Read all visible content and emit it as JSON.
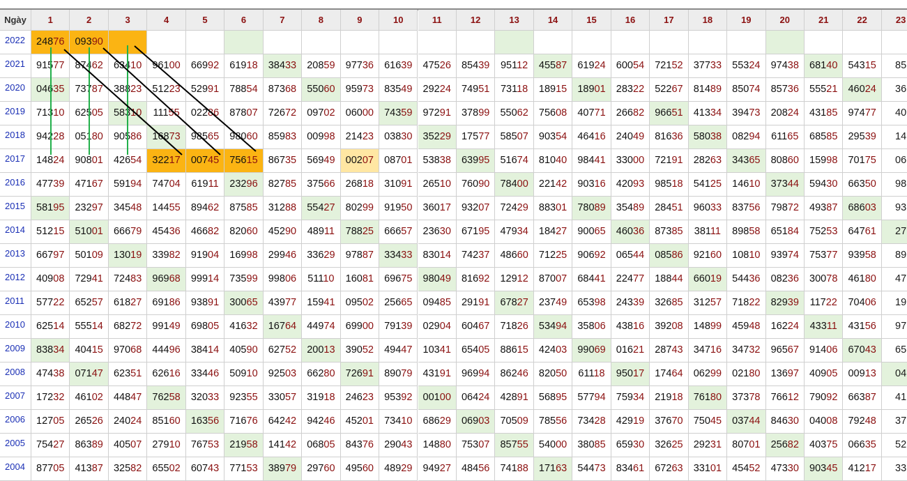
{
  "header": {
    "first": "Ngày",
    "days": [
      "1",
      "2",
      "3",
      "4",
      "5",
      "6",
      "7",
      "8",
      "9",
      "10",
      "11",
      "12",
      "13",
      "14",
      "15",
      "16",
      "17",
      "18",
      "19",
      "20",
      "21",
      "22",
      "23"
    ]
  },
  "rows": [
    {
      "year": "2022",
      "values": [
        "24876",
        "09390",
        "",
        "",
        "",
        "",
        "",
        "",
        "",
        "",
        "",
        "",
        "",
        "",
        "",
        "",
        "",
        "",
        "",
        "",
        "",
        "",
        ""
      ],
      "hl": {
        "0": "o",
        "1": "o",
        "2": "o",
        "5": "g",
        "12": "g",
        "19": "g"
      }
    },
    {
      "year": "2021",
      "values": [
        "91577",
        "87462",
        "63410",
        "96100",
        "66992",
        "61918",
        "38433",
        "20859",
        "97736",
        "61639",
        "47526",
        "85439",
        "95112",
        "45587",
        "61924",
        "60054",
        "72152",
        "37733",
        "55324",
        "97438",
        "68140",
        "54315",
        "85"
      ],
      "hl": {
        "6": "g",
        "13": "g",
        "20": "g"
      }
    },
    {
      "year": "2020",
      "values": [
        "04635",
        "73787",
        "38823",
        "51223",
        "52991",
        "78854",
        "87368",
        "55060",
        "95973",
        "83549",
        "29224",
        "74951",
        "73118",
        "18915",
        "18901",
        "28322",
        "52267",
        "81489",
        "85074",
        "85736",
        "55521",
        "46024",
        "36"
      ],
      "hl": {
        "0": "g",
        "7": "g",
        "14": "g",
        "21": "g"
      }
    },
    {
      "year": "2019",
      "values": [
        "71310",
        "62505",
        "58310",
        "11155",
        "02286",
        "87807",
        "72672",
        "09702",
        "06000",
        "74359",
        "97291",
        "37899",
        "55062",
        "75608",
        "40771",
        "26682",
        "96651",
        "41334",
        "39473",
        "20824",
        "43185",
        "97477",
        "40"
      ],
      "hl": {
        "2": "g",
        "9": "g",
        "16": "g"
      }
    },
    {
      "year": "2018",
      "values": [
        "94228",
        "05180",
        "90586",
        "16873",
        "98565",
        "98060",
        "85983",
        "00998",
        "21423",
        "03830",
        "35229",
        "17577",
        "58507",
        "90354",
        "46416",
        "24049",
        "81636",
        "58038",
        "08294",
        "61165",
        "68585",
        "29539",
        "14"
      ],
      "hl": {
        "3": "g",
        "10": "g",
        "17": "g"
      }
    },
    {
      "year": "2017",
      "values": [
        "14824",
        "90801",
        "42654",
        "32217",
        "00745",
        "75615",
        "86735",
        "56949",
        "00207",
        "08701",
        "53838",
        "63995",
        "51674",
        "81040",
        "98441",
        "33000",
        "72191",
        "28263",
        "34365",
        "80860",
        "15998",
        "70175",
        "06"
      ],
      "hl": {
        "3": "o",
        "4": "o",
        "5": "o",
        "8": "y",
        "11": "g",
        "18": "g"
      }
    },
    {
      "year": "2016",
      "values": [
        "47739",
        "47167",
        "59194",
        "74704",
        "61911",
        "23296",
        "82785",
        "37566",
        "26818",
        "31091",
        "26510",
        "76090",
        "78400",
        "22142",
        "90316",
        "42093",
        "98518",
        "54125",
        "14610",
        "37344",
        "59430",
        "66350",
        "98"
      ],
      "hl": {
        "5": "g",
        "12": "g",
        "19": "g"
      }
    },
    {
      "year": "2015",
      "values": [
        "58195",
        "23297",
        "34548",
        "14455",
        "89462",
        "87585",
        "31288",
        "55427",
        "80299",
        "91950",
        "36017",
        "93207",
        "72429",
        "88301",
        "78089",
        "35489",
        "28451",
        "96033",
        "83756",
        "79872",
        "49387",
        "68603",
        "93"
      ],
      "hl": {
        "0": "g",
        "7": "g",
        "14": "g",
        "21": "g"
      }
    },
    {
      "year": "2014",
      "values": [
        "51215",
        "51001",
        "66679",
        "45436",
        "46682",
        "82060",
        "45290",
        "48911",
        "78825",
        "66657",
        "23630",
        "67195",
        "47934",
        "18427",
        "90065",
        "46036",
        "87385",
        "38111",
        "89858",
        "65184",
        "75253",
        "64761",
        "27"
      ],
      "hl": {
        "1": "g",
        "8": "g",
        "15": "g",
        "22": "g"
      }
    },
    {
      "year": "2013",
      "values": [
        "66797",
        "50109",
        "13019",
        "33982",
        "91904",
        "16998",
        "29946",
        "33629",
        "97887",
        "33433",
        "83014",
        "74237",
        "48660",
        "71225",
        "90692",
        "06544",
        "08586",
        "92160",
        "10810",
        "93974",
        "75377",
        "93958",
        "89"
      ],
      "hl": {
        "2": "g",
        "9": "g",
        "16": "g"
      }
    },
    {
      "year": "2012",
      "values": [
        "40908",
        "72941",
        "72483",
        "96968",
        "99914",
        "73599",
        "99806",
        "51110",
        "16081",
        "69675",
        "98049",
        "81692",
        "12912",
        "87007",
        "68441",
        "22477",
        "18844",
        "66019",
        "54436",
        "08236",
        "30078",
        "46180",
        "47"
      ],
      "hl": {
        "3": "g",
        "10": "g",
        "17": "g"
      }
    },
    {
      "year": "2011",
      "values": [
        "57722",
        "65257",
        "61827",
        "69186",
        "93891",
        "30065",
        "43977",
        "15941",
        "09502",
        "25665",
        "09485",
        "29191",
        "67827",
        "23749",
        "65398",
        "24339",
        "32685",
        "31257",
        "71822",
        "82939",
        "11722",
        "70406",
        "19"
      ],
      "hl": {
        "5": "g",
        "12": "g",
        "19": "g"
      }
    },
    {
      "year": "2010",
      "values": [
        "62514",
        "55514",
        "68272",
        "99149",
        "69805",
        "41632",
        "16764",
        "44974",
        "69900",
        "79139",
        "02904",
        "60467",
        "71826",
        "53494",
        "35806",
        "43816",
        "39208",
        "14899",
        "45948",
        "16224",
        "43311",
        "43156",
        "97"
      ],
      "hl": {
        "6": "g",
        "13": "g",
        "20": "g"
      }
    },
    {
      "year": "2009",
      "values": [
        "83834",
        "40415",
        "97068",
        "44496",
        "38414",
        "40590",
        "62752",
        "20013",
        "39052",
        "49447",
        "10341",
        "65405",
        "88615",
        "42403",
        "99069",
        "01621",
        "28743",
        "34716",
        "34732",
        "96567",
        "91406",
        "67043",
        "65"
      ],
      "hl": {
        "0": "g",
        "7": "g",
        "14": "g",
        "21": "g"
      }
    },
    {
      "year": "2008",
      "values": [
        "47438",
        "07147",
        "62351",
        "62616",
        "33446",
        "50910",
        "92503",
        "66280",
        "72691",
        "89079",
        "43191",
        "96994",
        "86246",
        "82050",
        "61118",
        "95017",
        "17464",
        "06299",
        "02180",
        "13697",
        "40905",
        "00913",
        "04"
      ],
      "hl": {
        "1": "g",
        "8": "g",
        "15": "g",
        "22": "g"
      }
    },
    {
      "year": "2007",
      "values": [
        "17232",
        "46102",
        "44847",
        "76258",
        "32033",
        "92355",
        "33057",
        "31918",
        "24623",
        "95392",
        "00100",
        "06424",
        "42891",
        "56895",
        "57794",
        "75934",
        "21918",
        "76180",
        "37378",
        "76612",
        "79092",
        "66387",
        "41"
      ],
      "hl": {
        "3": "g",
        "10": "g",
        "17": "g"
      }
    },
    {
      "year": "2006",
      "values": [
        "12705",
        "26526",
        "24024",
        "85160",
        "16356",
        "71676",
        "64242",
        "94246",
        "45201",
        "73410",
        "68629",
        "06903",
        "70509",
        "78556",
        "73428",
        "42919",
        "37670",
        "75045",
        "03744",
        "84630",
        "04008",
        "79248",
        "37"
      ],
      "hl": {
        "4": "g",
        "11": "g",
        "18": "g"
      }
    },
    {
      "year": "2005",
      "values": [
        "75427",
        "86389",
        "40507",
        "27910",
        "76753",
        "21958",
        "14142",
        "06805",
        "84376",
        "29043",
        "14880",
        "75307",
        "85755",
        "54000",
        "38085",
        "65930",
        "32625",
        "29231",
        "80701",
        "25682",
        "40375",
        "06635",
        "52"
      ],
      "hl": {
        "5": "g",
        "12": "g",
        "19": "g"
      }
    },
    {
      "year": "2004",
      "values": [
        "87705",
        "41387",
        "32582",
        "65502",
        "60743",
        "77153",
        "38979",
        "29760",
        "49560",
        "48929",
        "94927",
        "48456",
        "74188",
        "17163",
        "54473",
        "83461",
        "67263",
        "33101",
        "45452",
        "47330",
        "90345",
        "41217",
        "33"
      ],
      "hl": {
        "6": "g",
        "13": "g",
        "20": "g"
      }
    }
  ],
  "overlay": {
    "green_color": "#22b04b",
    "black_color": "#000000"
  }
}
